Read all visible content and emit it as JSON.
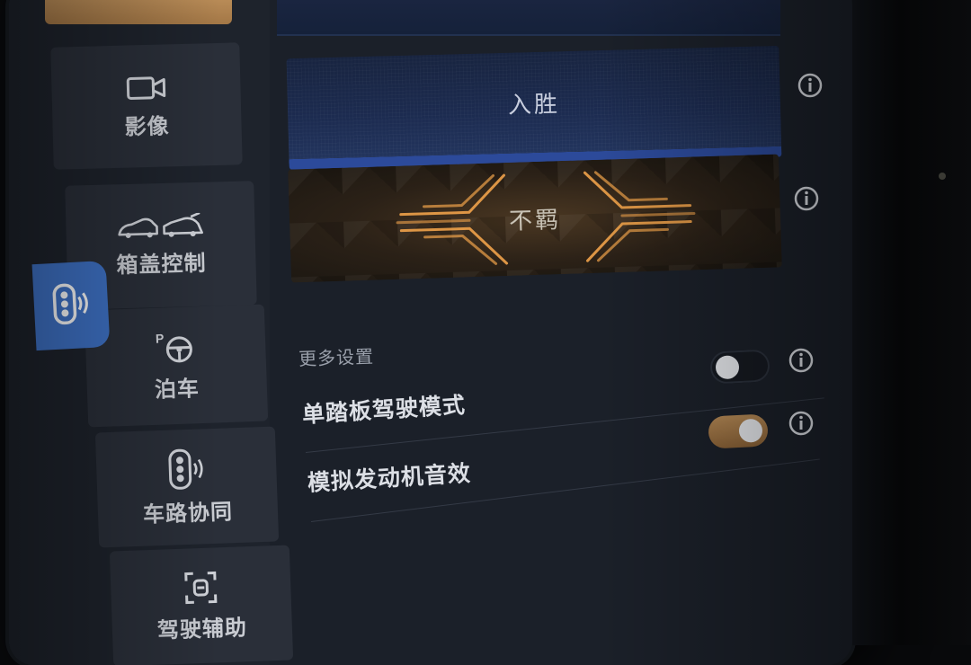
{
  "sidebar": {
    "items": [
      {
        "label": "影像",
        "icon": "camera-icon"
      },
      {
        "label": "箱盖控制",
        "icon": "car-trunk-icon"
      },
      {
        "label": "泊车",
        "icon": "parking-wheel-icon"
      },
      {
        "label": "车路协同",
        "icon": "traffic-light-signal-icon"
      },
      {
        "label": "驾驶辅助",
        "icon": "driver-assist-icon"
      }
    ],
    "active_tab_icon": "traffic-light-signal-icon"
  },
  "modes": [
    {
      "label": "入胜",
      "theme": "blue"
    },
    {
      "label": "不羁",
      "theme": "gold"
    }
  ],
  "more_settings": {
    "title": "更多设置",
    "rows": [
      {
        "label": "单踏板驾驶模式",
        "enabled": false
      },
      {
        "label": "模拟发动机音效",
        "enabled": true
      }
    ]
  },
  "colors": {
    "accent_gold": "#b58955",
    "accent_blue": "#3f73c8",
    "panel_bg": "#1b2029"
  }
}
